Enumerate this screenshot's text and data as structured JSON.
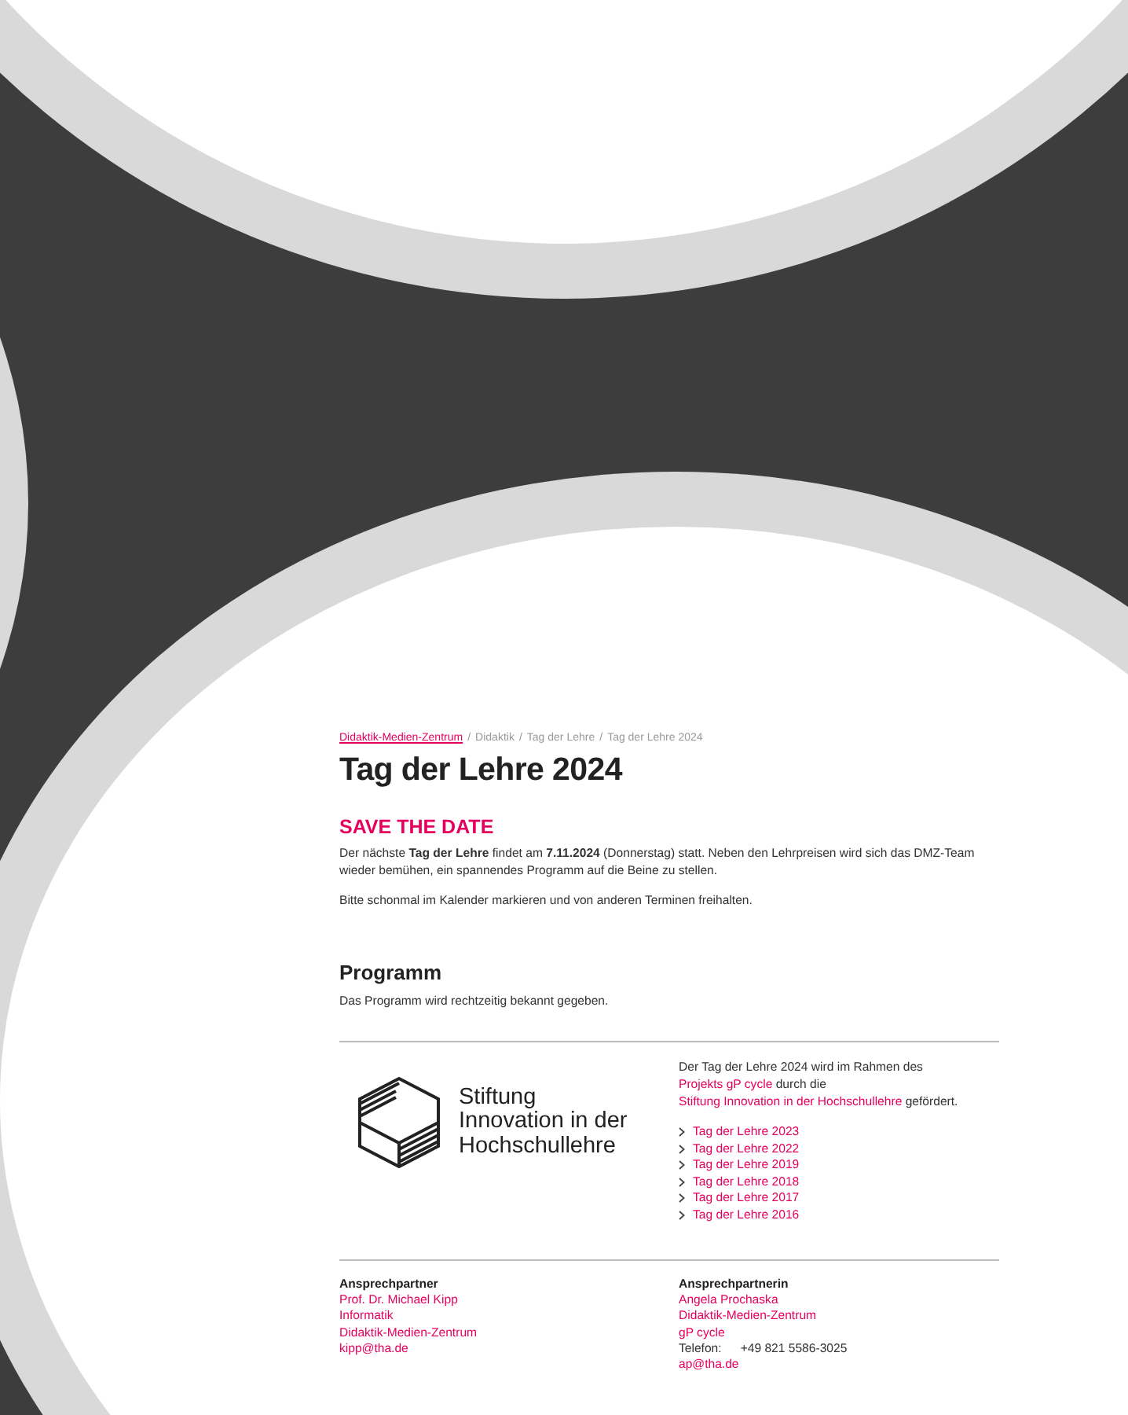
{
  "breadcrumb": [
    {
      "label": "Didaktik-Medien-Zentrum",
      "kind": "link"
    },
    {
      "label": "Didaktik",
      "kind": "text",
      "separator": "/"
    },
    {
      "label": "Tag der Lehre",
      "kind": "text",
      "separator": "/"
    },
    {
      "label": "Tag der Lehre 2024",
      "kind": "text",
      "separator": "/"
    }
  ],
  "title": "Tag der Lehre 2024",
  "highlight": "SAVE THE DATE",
  "paragraphs": [
    "Der nächste **Tag der Lehre** findet am **7.11.2024** (Donnerstag) statt. Neben den Lehrpreisen wird sich das DMZ-Team wieder bemühen, ein spannendes Programm auf die Beine zu stellen.",
    "Bitte schonmal im Kalender markieren und von anderen Terminen freihalten."
  ],
  "program": {
    "heading": "Programm",
    "text": "Das Programm wird rechtzeitig bekannt gegeben."
  },
  "sponsor": {
    "logo_text": [
      "Stiftung",
      "Innovation in der",
      "Hochschullehre"
    ],
    "note": [
      {
        "kind": "text",
        "text": "Der Tag der Lehre 2024 wird im Rahmen des "
      },
      {
        "kind": "link",
        "text": "Projekts gP cycle"
      },
      {
        "kind": "text",
        "text": " durch die "
      },
      {
        "kind": "link",
        "text": "Stiftung Innovation in der Hochschullehre"
      },
      {
        "kind": "text",
        "text": " gefördert."
      }
    ],
    "links": [
      "Tag der Lehre 2023",
      "Tag der Lehre 2022",
      "Tag der Lehre 2019",
      "Tag der Lehre 2018",
      "Tag der Lehre 2017",
      "Tag der Lehre 2016"
    ]
  },
  "contacts": [
    {
      "heading": "Ansprechpartner",
      "lines": [
        {
          "kind": "link",
          "text": "Prof. Dr. Michael Kipp"
        },
        {
          "kind": "link",
          "text": "Informatik"
        },
        {
          "kind": "link",
          "text": "Didaktik-Medien-Zentrum"
        },
        {
          "kind": "link",
          "text": "kipp@tha.de"
        }
      ]
    },
    {
      "heading": "Ansprechpartnerin",
      "lines": [
        {
          "kind": "link",
          "text": "Angela Prochaska"
        },
        {
          "kind": "link",
          "text": "Didaktik-Medien-Zentrum"
        },
        {
          "kind": "link",
          "text": "gP cycle"
        },
        {
          "kind": "phone",
          "label": "Telefon:",
          "text": "+49 821 5586-3025"
        },
        {
          "kind": "link",
          "text": "ap@tha.de"
        }
      ]
    }
  ]
}
